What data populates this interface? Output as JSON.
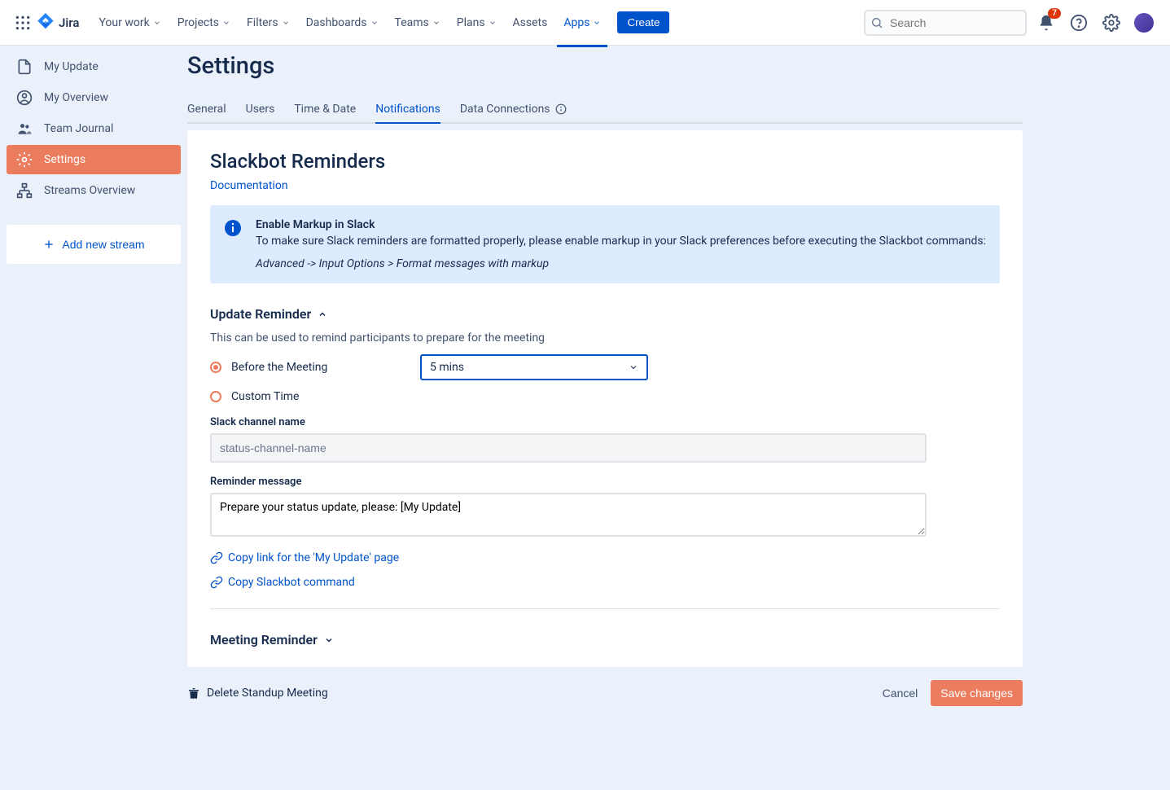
{
  "topnav": {
    "logo_text": "Jira",
    "items": [
      {
        "label": "Your work",
        "has_chevron": true
      },
      {
        "label": "Projects",
        "has_chevron": true
      },
      {
        "label": "Filters",
        "has_chevron": true
      },
      {
        "label": "Dashboards",
        "has_chevron": true
      },
      {
        "label": "Teams",
        "has_chevron": true
      },
      {
        "label": "Plans",
        "has_chevron": true
      },
      {
        "label": "Assets",
        "has_chevron": false
      },
      {
        "label": "Apps",
        "has_chevron": true,
        "active": true
      }
    ],
    "create": "Create",
    "search_placeholder": "Search",
    "notification_count": "7"
  },
  "sidebar": {
    "items": [
      {
        "label": "My Update",
        "icon": "document"
      },
      {
        "label": "My Overview",
        "icon": "user-circle"
      },
      {
        "label": "Team Journal",
        "icon": "users"
      },
      {
        "label": "Settings",
        "icon": "gear",
        "active": true
      },
      {
        "label": "Streams Overview",
        "icon": "sitemap"
      }
    ],
    "add_stream": "Add new stream"
  },
  "page": {
    "title": "Settings",
    "tabs": [
      {
        "label": "General"
      },
      {
        "label": "Users"
      },
      {
        "label": "Time & Date"
      },
      {
        "label": "Notifications",
        "active": true
      },
      {
        "label": "Data Connections",
        "has_info": true
      }
    ]
  },
  "panel": {
    "heading": "Slackbot Reminders",
    "doc_link": "Documentation",
    "info": {
      "title": "Enable Markup in Slack",
      "text": "To make sure Slack reminders are formatted properly, please enable markup in your Slack preferences before executing the Slackbot commands:",
      "path": "Advanced -> Input Options > Format messages with markup"
    },
    "update_reminder": {
      "title": "Update Reminder",
      "desc": "This can be used to remind participants to prepare for the meeting",
      "option_before": "Before the Meeting",
      "option_custom": "Custom Time",
      "select_value": "5 mins",
      "channel_label": "Slack channel name",
      "channel_value": "status-channel-name",
      "message_label": "Reminder message",
      "message_value": "Prepare your status update, please: [My Update]",
      "copy_my_update": "Copy link for the 'My Update' page",
      "copy_slackbot": "Copy Slackbot command"
    },
    "meeting_reminder": {
      "title": "Meeting Reminder"
    }
  },
  "footer": {
    "delete": "Delete Standup Meeting",
    "cancel": "Cancel",
    "save": "Save changes"
  }
}
